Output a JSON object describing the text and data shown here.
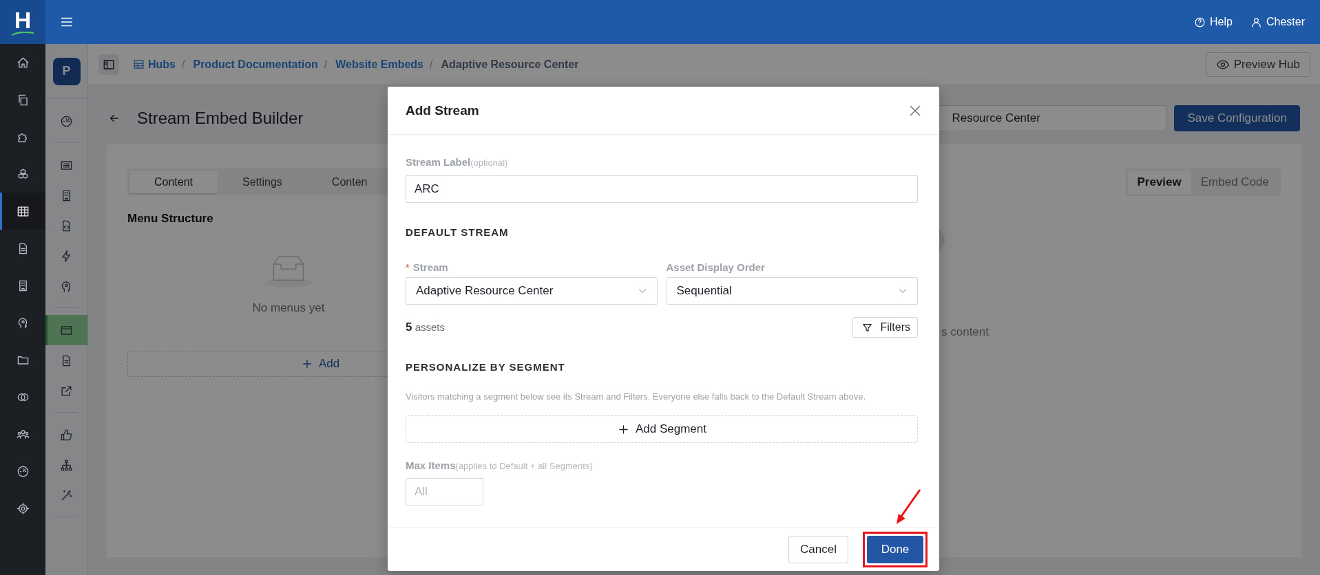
{
  "topbar": {
    "logo": "H",
    "help": "Help",
    "user": "Chester"
  },
  "main_nav": [
    {
      "selected": false
    },
    {
      "selected": false
    },
    {
      "selected": false
    },
    {
      "selected": false
    },
    {
      "selected": true
    },
    {
      "selected": false
    },
    {
      "selected": false
    },
    {
      "selected": false
    },
    {
      "selected": false
    },
    {
      "selected": false
    },
    {
      "selected": false
    },
    {
      "selected": false
    },
    {
      "selected": false
    }
  ],
  "sub_nav": {
    "avatar": "P",
    "groups": [
      [
        {
          "selected": false
        }
      ],
      [
        {
          "selected": false
        },
        {
          "selected": false
        },
        {
          "selected": false
        },
        {
          "selected": false
        },
        {
          "selected": false
        }
      ],
      [
        {
          "selected": true
        },
        {
          "selected": false
        },
        {
          "selected": false
        }
      ],
      [
        {
          "selected": false
        },
        {
          "selected": false
        },
        {
          "selected": false
        }
      ]
    ]
  },
  "breadcrumb": [
    {
      "label": "Hubs",
      "separator": "/"
    },
    {
      "label": "Product Documentation",
      "separator": "/"
    },
    {
      "label": "Website Embeds",
      "separator": "/"
    },
    {
      "label": "Adaptive Resource Center"
    }
  ],
  "preview_hub_button": "Preview Hub",
  "builder": {
    "title": "Stream Embed Builder",
    "name_field": "Resource Center",
    "save_button": "Save Configuration",
    "tabs": [
      {
        "label": "Content",
        "selected": true
      },
      {
        "label": "Settings",
        "selected": false
      },
      {
        "label": "Conten",
        "selected": false
      }
    ],
    "menu_structure": {
      "title": "Menu Structure",
      "empty_text": "No menus yet",
      "add_button": "Add"
    },
    "preview_tabs": [
      {
        "label": "Preview",
        "selected": true
      },
      {
        "label": "Embed Code",
        "selected": false
      }
    ],
    "preview_text": "s content"
  },
  "modal": {
    "title": "Add Stream",
    "stream_label": {
      "label": "Stream Label",
      "hint": "(optional)",
      "value": "ARC"
    },
    "default_stream": {
      "heading": "DEFAULT STREAM",
      "stream": {
        "label": "Stream",
        "required_mark": "*",
        "value": "Adaptive Resource Center"
      },
      "order": {
        "label": "Asset Display Order",
        "value": "Sequential"
      },
      "asset_count": "**5** assets",
      "filters_button": "Filters"
    },
    "segment": {
      "heading": "PERSONALIZE BY SEGMENT",
      "description": "Visitors matching a segment below see its Stream and Filters. Everyone else falls back to the Default Stream above.",
      "add_button": "Add Segment"
    },
    "max_items": {
      "label": "Max Items",
      "hint": "(applies to Default + all Segments)",
      "placeholder": "All"
    },
    "cancel_button": "Cancel",
    "done_button": "Done"
  }
}
